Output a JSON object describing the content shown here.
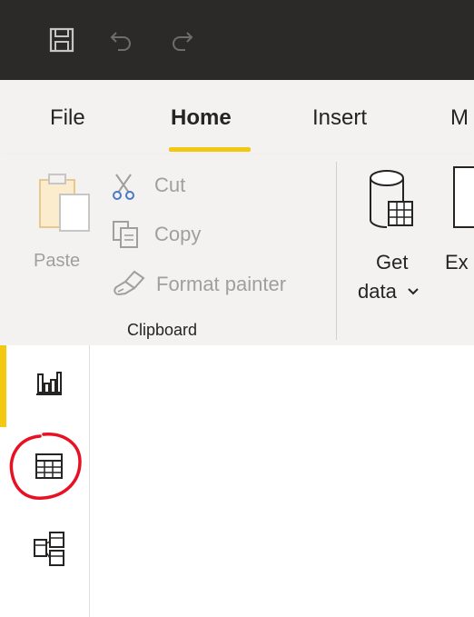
{
  "titlebar": {
    "icons": [
      "save-icon",
      "undo-icon",
      "redo-icon"
    ]
  },
  "menu": {
    "tabs": [
      {
        "label": "File",
        "active": false
      },
      {
        "label": "Home",
        "active": true
      },
      {
        "label": "Insert",
        "active": false
      },
      {
        "label": "M",
        "active": false
      }
    ]
  },
  "ribbon": {
    "clipboard": {
      "paste_label": "Paste",
      "cut_label": "Cut",
      "copy_label": "Copy",
      "format_painter_label": "Format painter",
      "group_label": "Clipboard"
    },
    "data": {
      "get_data_line1": "Get",
      "get_data_line2": "data",
      "excel_label": "Ex"
    }
  },
  "leftnav": {
    "items": [
      {
        "name": "report-view",
        "icon": "bar-chart-icon",
        "active": true
      },
      {
        "name": "data-view",
        "icon": "table-icon",
        "active": false
      },
      {
        "name": "model-view",
        "icon": "model-icon",
        "active": false
      }
    ]
  },
  "colors": {
    "titlebar": "#2b2a29",
    "accent": "#f2c811",
    "ribbon_bg": "#f3f2f1",
    "annotation": "#e81123"
  }
}
